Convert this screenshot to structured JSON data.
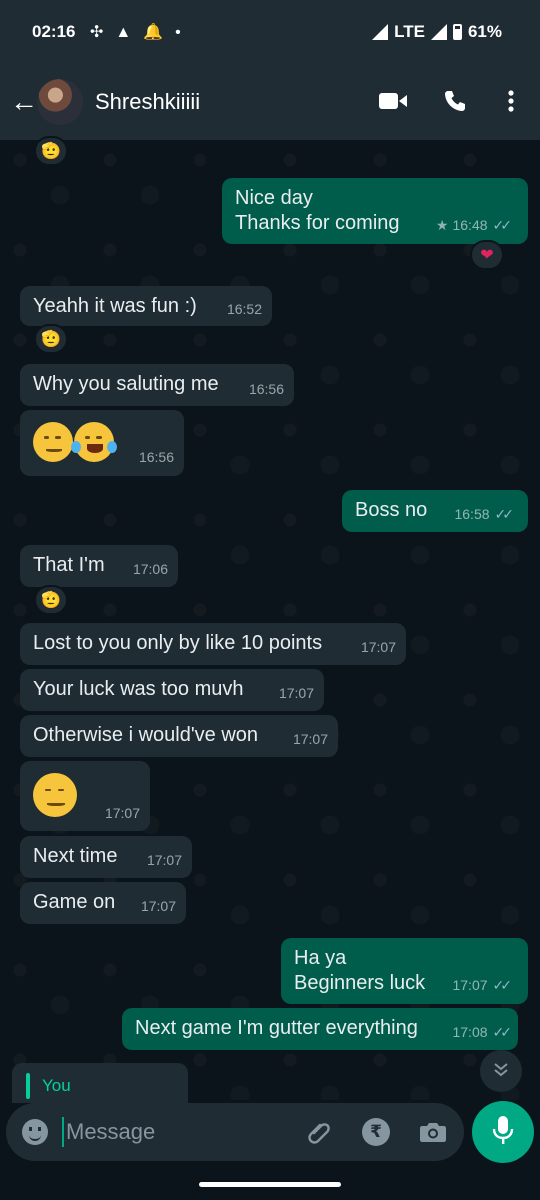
{
  "status_bar": {
    "time": "02:16",
    "network": "LTE",
    "battery": "61%"
  },
  "header": {
    "contact_name": "Shreshkiiiii"
  },
  "messages": [
    {
      "dir": "out",
      "lines": [
        "Nice day",
        "Thanks for coming"
      ],
      "time": "16:48",
      "starred": true,
      "reaction": "heart-emoji"
    },
    {
      "dir": "in",
      "text": "Yeahh it was fun :)",
      "time": "16:52",
      "reaction": "saluting-face-emoji"
    },
    {
      "dir": "in",
      "text": "Why you saluting me",
      "time": "16:56"
    },
    {
      "dir": "in",
      "emojis": [
        "smirking-face",
        "tears-of-joy-face"
      ],
      "time": "16:56"
    },
    {
      "dir": "out",
      "text": "Boss no",
      "time": "16:58"
    },
    {
      "dir": "in",
      "text": "That I'm",
      "time": "17:06",
      "reaction": "saluting-face-emoji"
    },
    {
      "dir": "in",
      "text": "Lost to you only by like 10 points",
      "time": "17:07"
    },
    {
      "dir": "in",
      "text": "Your luck was too muvh",
      "time": "17:07"
    },
    {
      "dir": "in",
      "text": "Otherwise i would've won",
      "time": "17:07"
    },
    {
      "dir": "in",
      "emojis": [
        "smirking-face"
      ],
      "time": "17:07"
    },
    {
      "dir": "in",
      "text": "Next time",
      "time": "17:07"
    },
    {
      "dir": "in",
      "text": "Game on",
      "time": "17:07"
    },
    {
      "dir": "out",
      "lines": [
        "Ha ya",
        "Beginners luck"
      ],
      "time": "17:07"
    },
    {
      "dir": "out",
      "text": "Next game I'm gutter everything",
      "time": "17:08"
    }
  ],
  "reply_preview": {
    "author": "You"
  },
  "composer": {
    "placeholder": "Message"
  },
  "colors": {
    "background": "#0b141a",
    "incoming_bubble": "#1f2c34",
    "outgoing_bubble": "#005c4b",
    "accent": "#00a884",
    "read_ticks": "#8fb8c8"
  }
}
